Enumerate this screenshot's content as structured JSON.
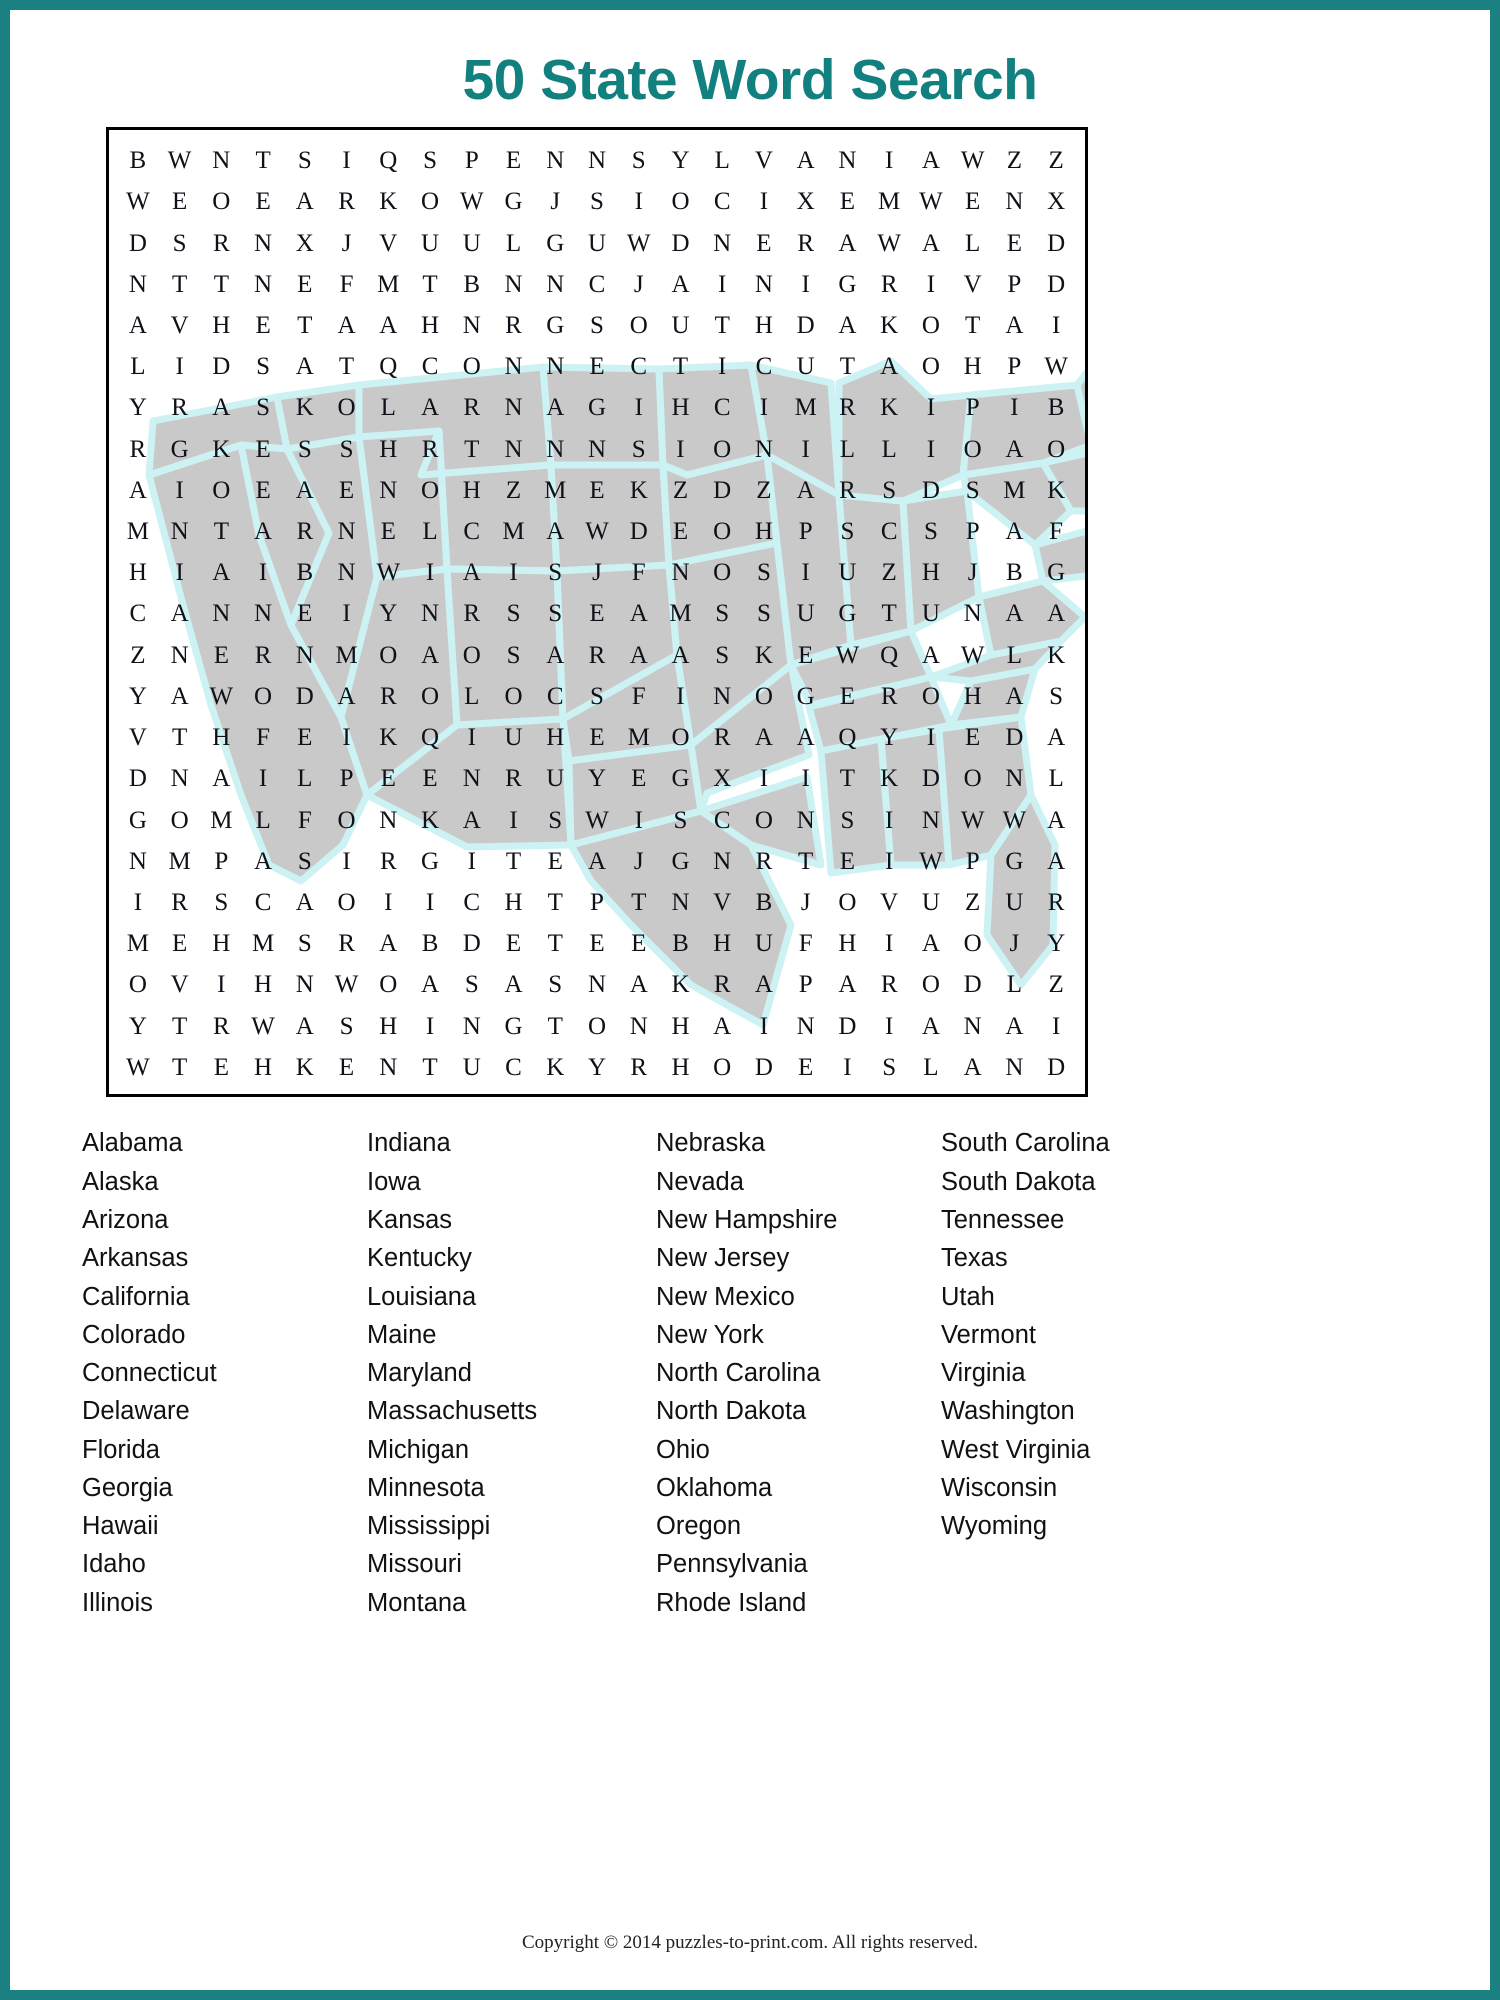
{
  "page": {
    "title": "50 State Word Search",
    "border_color": "#1a8080",
    "title_color": "#11807e"
  },
  "puzzle": {
    "rows": 23,
    "cols": 23,
    "grid": [
      "BWNTSIQSPENNSYLVANIAWZZ",
      "WEOEARKOWGJSIOCIXEMWENX",
      "DSRNXJVUULGUWDNERAWALED",
      "NTTNEFMTBNNCJAINIGRIVPD",
      "AVHETAAHNRGSOUTHDAKOTAI",
      "LIDSATQCONNECTICUTAOHPW",
      "YRASKOLARNAGIHCIMRKIPIB",
      "RGKESSHRTNNNSIONILLIOAO",
      "AIOEAENOHZMEKZDZARSDSMK",
      "MNTARNELCMAWDEOHPSCSPAF",
      "HIAIBNWIAISJFNOSIUZHJBG",
      "CANNEIYNRSSEAMSSUGTUNAA",
      "ZNERNMOAOSARAASKEWQAWLK",
      "YAWODAROLOCSFINOGEROHAS",
      "VTHFEIKQIUHEMORAAQYIEDA",
      "DNAILPEENRUYEGXIITKDONL",
      "GOMLFONKAISWISCONSINWWA",
      "NMPASIRGITEAJGNRTEIWPGA",
      "IRSCAOIICHTPTNVBJOVUZUR",
      "MEHMSRABDETEEBHUFHIAOJY",
      "OVIHNWOASASNAKRAPARODLZ",
      "YTRWASHINGTONHAINDIANAI",
      "WTEHKENTUCKYRHODEISLAND"
    ]
  },
  "word_list": {
    "columns": [
      [
        "Alabama",
        "Alaska",
        "Arizona",
        "Arkansas",
        "California",
        "Colorado",
        "Connecticut",
        "Delaware",
        "Florida",
        "Georgia",
        "Hawaii",
        "Idaho",
        "Illinois"
      ],
      [
        "Indiana",
        "Iowa",
        "Kansas",
        "Kentucky",
        "Louisiana",
        "Maine",
        "Maryland",
        "Massachusetts",
        "Michigan",
        "Minnesota",
        "Mississippi",
        "Missouri",
        "Montana"
      ],
      [
        "Nebraska",
        "Nevada",
        "New Hampshire",
        "New Jersey",
        "New Mexico",
        "New York",
        "North Carolina",
        "North Dakota",
        "Ohio",
        "Oklahoma",
        "Oregon",
        "Pennsylvania",
        "Rhode Island"
      ],
      [
        "South Carolina",
        "South Dakota",
        "Tennessee",
        "Texas",
        "Utah",
        "Vermont",
        "Virginia",
        "Washington",
        "West Virginia",
        "Wisconsin",
        "Wyoming"
      ]
    ]
  },
  "footer": {
    "copyright": "Copyright © 2014 puzzles-to-print.com. All rights reserved."
  },
  "map": {
    "fill_color": "#c9c9c9",
    "stroke_color": "#cdf2f4"
  }
}
